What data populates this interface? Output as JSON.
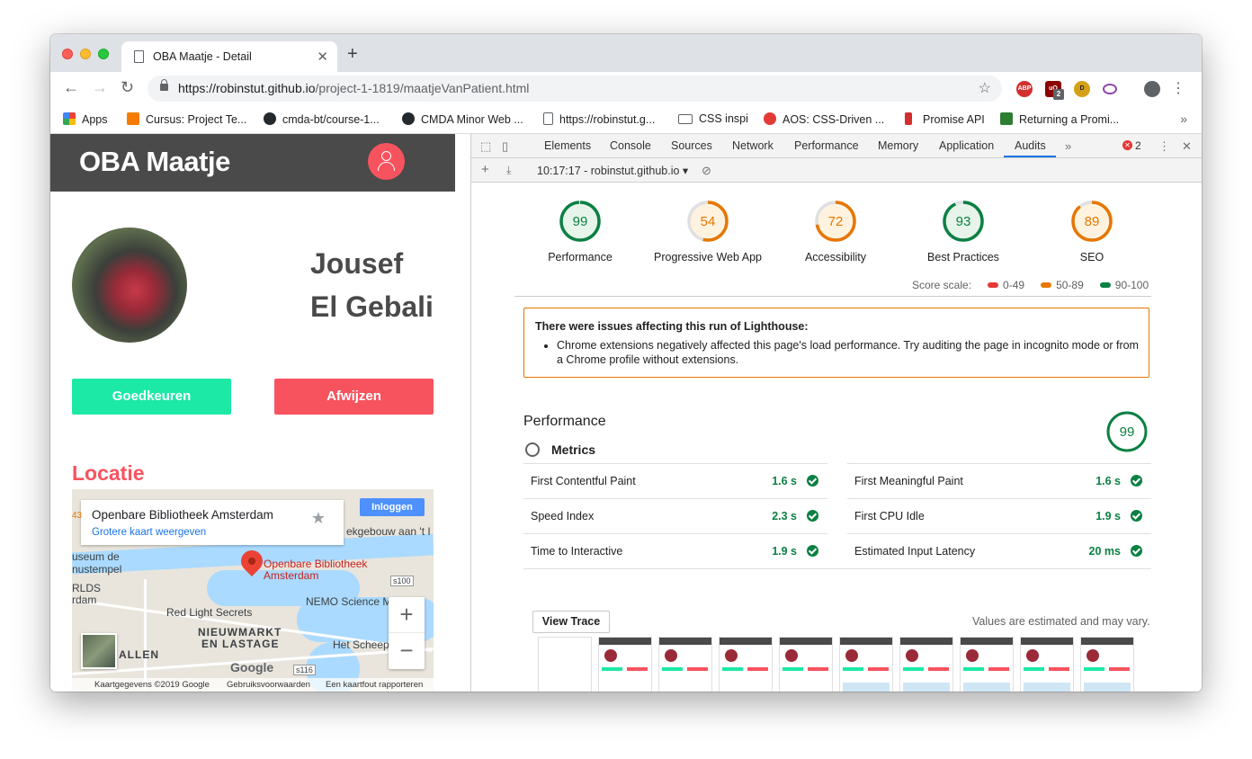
{
  "browser": {
    "tab_title": "OBA Maatje - Detail",
    "url_host": "https://robinstut.github.io",
    "url_path": "/project-1-1819/maatjeVanPatient.html",
    "ext_badge": "2",
    "bookmarks": [
      {
        "label": "Apps",
        "icon": "apps-icon",
        "color": "#ea4335"
      },
      {
        "label": "Cursus: Project Te...",
        "icon": "bookmark-favicon",
        "color": "#f57c00"
      },
      {
        "label": "cmda-bt/course-1...",
        "icon": "github-icon",
        "color": "#24292e"
      },
      {
        "label": "CMDA Minor Web ...",
        "icon": "github-icon",
        "color": "#24292e"
      },
      {
        "label": "https://robinstut.g...",
        "icon": "page-icon",
        "color": "#ffffff"
      },
      {
        "label": "CSS inspi",
        "icon": "folder-icon",
        "color": "#ffffff"
      },
      {
        "label": "AOS: CSS-Driven ...",
        "icon": "aos-icon",
        "color": "#e53935"
      },
      {
        "label": "Promise API",
        "icon": "tower-icon",
        "color": "#d32f2f"
      },
      {
        "label": "Returning a Promi...",
        "icon": "bookmark-favicon",
        "color": "#2e7d32"
      }
    ]
  },
  "webpage": {
    "title": "OBA Maatje",
    "first_name": "Jousef",
    "last_name": "El Gebali",
    "approve_label": "Goedkeuren",
    "reject_label": "Afwijzen",
    "location_heading": "Locatie",
    "map": {
      "place_title": "Openbare Bibliotheek Amsterdam",
      "larger_map_link": "Grotere kaart weergeven",
      "login_label": "Inloggen",
      "pin_label_line1": "Openbare Bibliotheek",
      "pin_label_line2": "Amsterdam",
      "labels": [
        "useum de",
        "nustempel",
        "RLDS",
        "rdam",
        "Red Light Secrets",
        "NEMO Science M",
        "NIEUWMARKT",
        "EN LASTAGE",
        "Het Scheep",
        "ALLEN",
        "ekgebouw aan 't I",
        "43",
        "s100",
        "s116"
      ],
      "logo": "Google",
      "footer": [
        "Kaartgegevens ©2019 Google",
        "Gebruiksvoorwaarden",
        "Een kaartfout rapporteren"
      ]
    }
  },
  "devtools": {
    "tabs": [
      "Elements",
      "Console",
      "Sources",
      "Network",
      "Performance",
      "Memory",
      "Application",
      "Audits"
    ],
    "active_tab": "Audits",
    "error_count": "2",
    "run_label": "10:17:17 - robinstut.github.io",
    "scores": [
      {
        "label": "Performance",
        "value": 99,
        "color": "#0b8043"
      },
      {
        "label": "Progressive Web App",
        "value": 54,
        "color": "#e67700"
      },
      {
        "label": "Accessibility",
        "value": 72,
        "color": "#e67700"
      },
      {
        "label": "Best Practices",
        "value": 93,
        "color": "#0b8043"
      },
      {
        "label": "SEO",
        "value": 89,
        "color": "#e67700"
      }
    ],
    "score_scale_label": "Score scale:",
    "score_scale": [
      {
        "range": "0-49",
        "color": "#e53935"
      },
      {
        "range": "50-89",
        "color": "#e67700"
      },
      {
        "range": "90-100",
        "color": "#0b8043"
      }
    ],
    "warning_title": "There were issues affecting this run of Lighthouse:",
    "warning_item": "Chrome extensions negatively affected this page's load performance. Try auditing the page in incognito mode or from a Chrome profile without extensions.",
    "performance_heading": "Performance",
    "performance_score": 99,
    "metrics_heading": "Metrics",
    "metrics": [
      {
        "name": "First Contentful Paint",
        "value": "1.6 s"
      },
      {
        "name": "First Meaningful Paint",
        "value": "1.6 s"
      },
      {
        "name": "Speed Index",
        "value": "2.3 s"
      },
      {
        "name": "First CPU Idle",
        "value": "1.9 s"
      },
      {
        "name": "Time to Interactive",
        "value": "1.9 s"
      },
      {
        "name": "Estimated Input Latency",
        "value": "20 ms"
      }
    ],
    "view_trace_label": "View Trace",
    "estimated_note": "Values are estimated and may vary."
  }
}
